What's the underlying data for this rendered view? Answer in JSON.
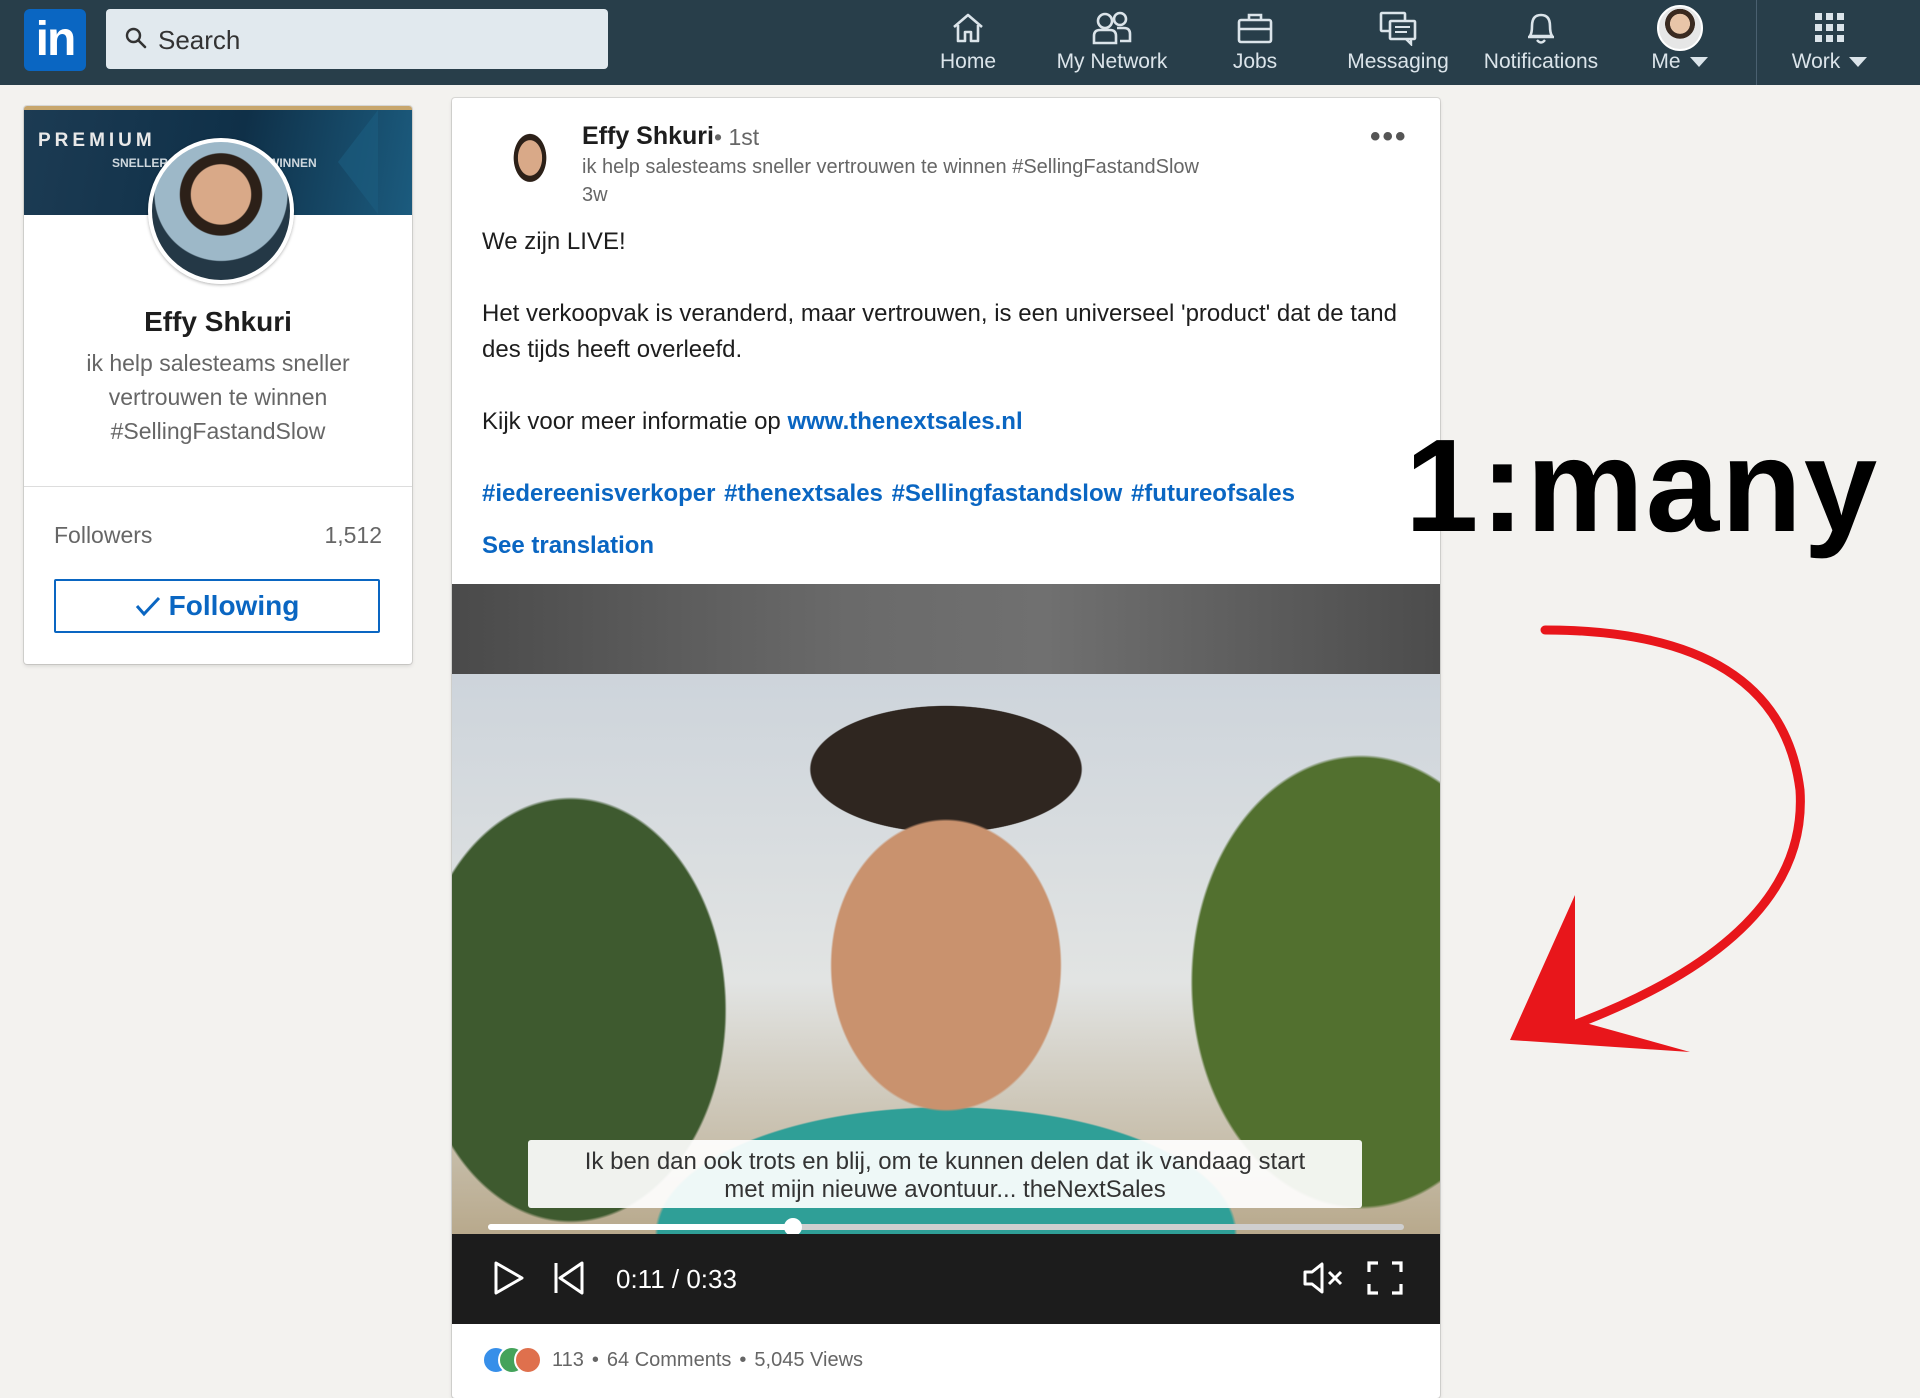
{
  "nav": {
    "logo_text": "in",
    "search_placeholder": "Search",
    "items": [
      {
        "label": "Home",
        "icon": "home-icon"
      },
      {
        "label": "My Network",
        "icon": "network-icon"
      },
      {
        "label": "Jobs",
        "icon": "briefcase-icon"
      },
      {
        "label": "Messaging",
        "icon": "messaging-icon"
      },
      {
        "label": "Notifications",
        "icon": "bell-icon"
      },
      {
        "label": "Me",
        "icon": "avatar"
      },
      {
        "label": "Work",
        "icon": "grid-icon"
      }
    ]
  },
  "profile": {
    "banner_label": "PREMIUM",
    "banner_text_left": "SNELLER",
    "banner_text_right": "WINNEN",
    "name": "Effy Shkuri",
    "headline": "ik help salesteams sneller vertrouwen te winnen #SellingFastandSlow",
    "followers_label": "Followers",
    "followers_count": "1,512",
    "following_button": "Following"
  },
  "post": {
    "author": "Effy Shkuri",
    "degree": "• 1st",
    "author_headline": "ik help salesteams sneller vertrouwen te winnen #SellingFastandSlow",
    "time": "3w",
    "paragraph1": "We zijn LIVE!",
    "paragraph2": "Het verkoopvak is veranderd, maar vertrouwen, is een universeel 'product' dat de tand des tijds heeft overleefd.",
    "paragraph3_prefix": "Kijk voor meer informatie op ",
    "paragraph3_link": "www.thenextsales.nl",
    "hashtags": "#iedereenisverkoper #thenextsales #Sellingfastandslow #futureofsales",
    "see_translation": "See translation",
    "video": {
      "caption_line1": "Ik ben dan ook trots en blij, om te kunnen delen dat ik vandaag start",
      "caption_line2": "met mijn nieuwe avontuur... theNextSales",
      "time": "0:11 / 0:33",
      "progress_fraction": 0.333
    },
    "social": {
      "reactions": "113",
      "sep1": "•",
      "comments": "64 Comments",
      "sep2": "•",
      "views": "5,045 Views"
    }
  },
  "annotation": {
    "text": "1:many",
    "arrow_color": "#e8161b"
  },
  "colors": {
    "nav_bg": "#283e4a",
    "link": "#0a66c2",
    "page_bg": "#f3f2ef"
  }
}
